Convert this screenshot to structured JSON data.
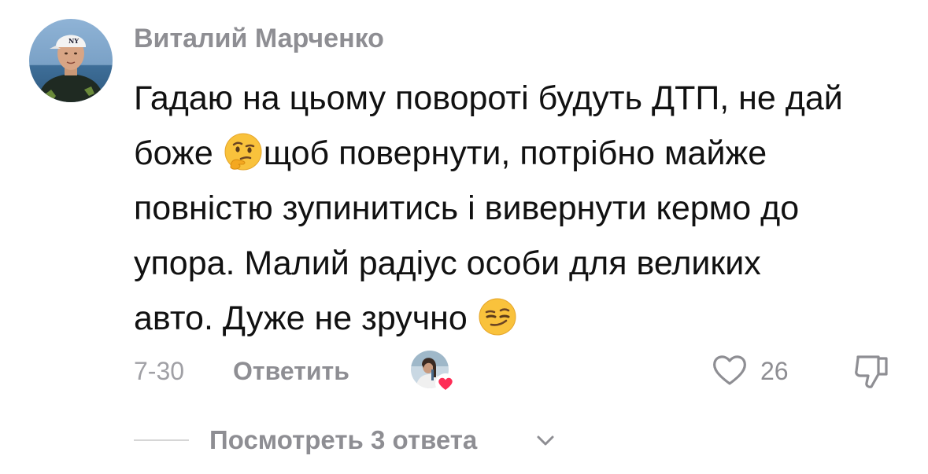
{
  "comment": {
    "author": "Виталий Марченко",
    "lines": [
      "Гадаю на цьому повороті будуть ДТП, не дай",
      "боже ",
      "щоб повернути, потрібно майже",
      "повністю зупинитись і вивернути кермо до",
      "упора. Малий радіус особи для великих",
      "авто. Дуже не зручно "
    ],
    "emojis": [
      "thinking-face-emoji",
      "smirking-face-emoji"
    ],
    "date": "7-30",
    "reply_label": "Ответить",
    "like_count": "26",
    "creator_liked": true
  },
  "replies": {
    "label": "Посмотреть 3 ответа"
  },
  "colors": {
    "author": "#8e8e93",
    "text": "#111111",
    "meta": "#8e8e93",
    "heart_badge": "#fe2c55"
  }
}
